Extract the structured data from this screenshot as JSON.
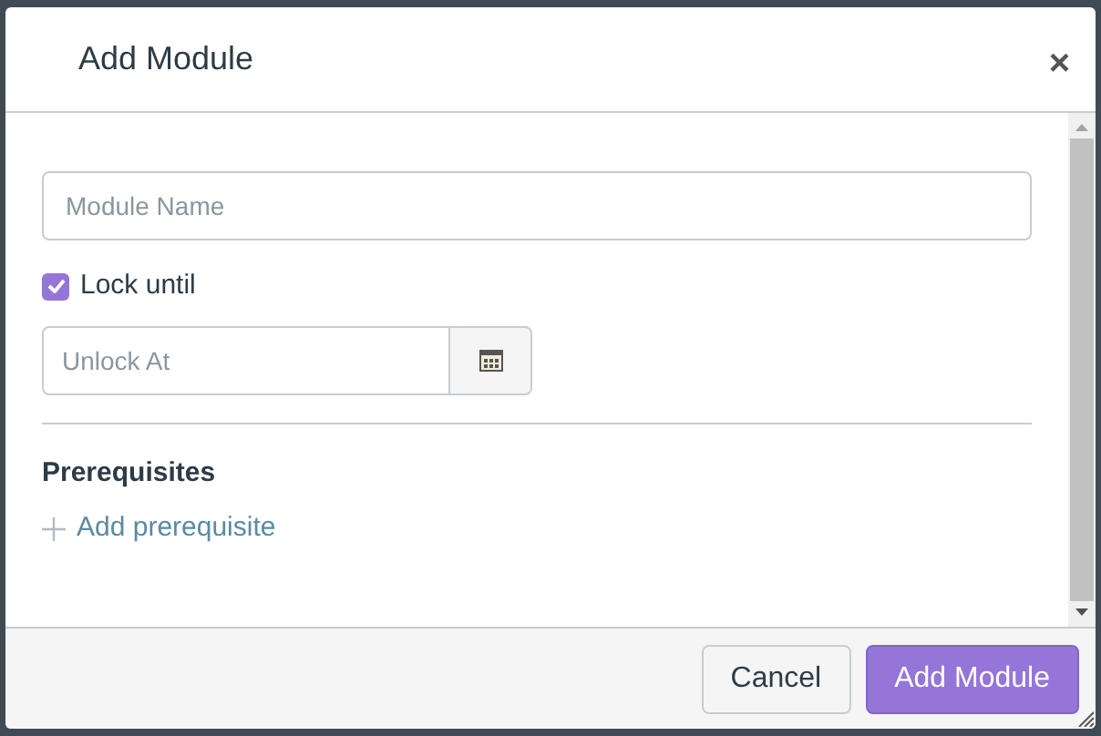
{
  "dialog": {
    "title": "Add Module",
    "close": "×"
  },
  "module_name": {
    "placeholder": "Module Name"
  },
  "lock_until": {
    "label": "Lock until",
    "checked": true
  },
  "unlock_at": {
    "placeholder": "Unlock At"
  },
  "prerequisites": {
    "heading": "Prerequisites",
    "add_link": "Add prerequisite"
  },
  "buttons": [
    {
      "label": "Cancel",
      "kind": "secondary"
    },
    {
      "label": "Add Module",
      "kind": "primary"
    }
  ]
}
